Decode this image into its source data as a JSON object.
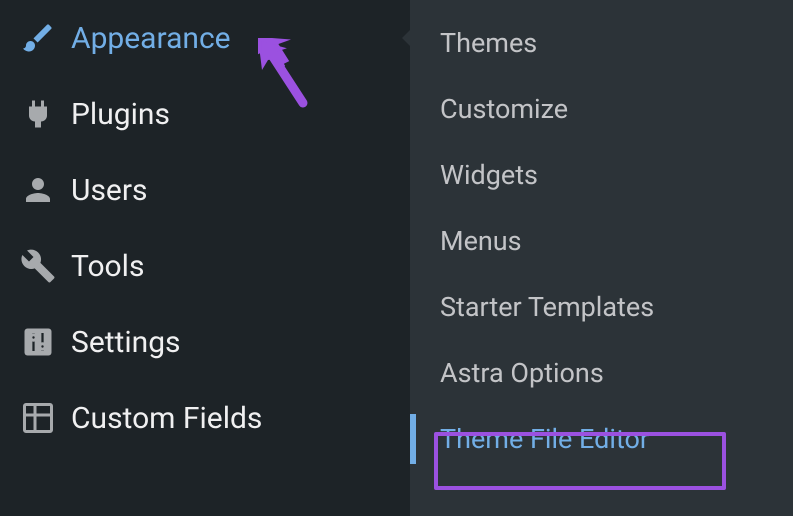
{
  "sidebar": {
    "items": [
      {
        "label": "Appearance",
        "icon": "paintbrush",
        "active": true
      },
      {
        "label": "Plugins",
        "icon": "plug",
        "active": false
      },
      {
        "label": "Users",
        "icon": "user",
        "active": false
      },
      {
        "label": "Tools",
        "icon": "wrench",
        "active": false
      },
      {
        "label": "Settings",
        "icon": "sliders",
        "active": false
      },
      {
        "label": "Custom Fields",
        "icon": "grid",
        "active": false
      }
    ]
  },
  "submenu": {
    "items": [
      {
        "label": "Themes"
      },
      {
        "label": "Customize"
      },
      {
        "label": "Widgets"
      },
      {
        "label": "Menus"
      },
      {
        "label": "Starter Templates"
      },
      {
        "label": "Astra Options"
      },
      {
        "label": "Theme File Editor",
        "highlighted": true
      }
    ]
  },
  "colors": {
    "accent": "#72aee6",
    "highlight": "#9b51e0",
    "bg_main": "#1d2327",
    "bg_sub": "#2c3338"
  }
}
